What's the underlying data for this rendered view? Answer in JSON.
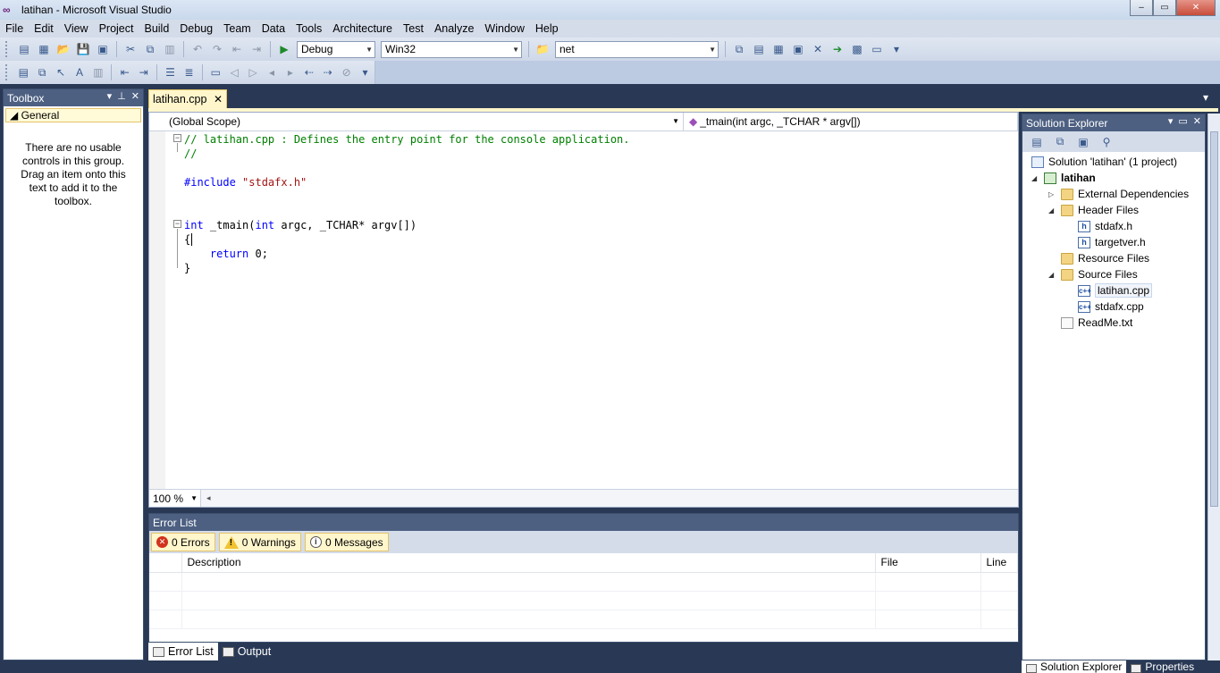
{
  "window": {
    "title": "latihan - Microsoft Visual Studio",
    "minimize": "–",
    "maximize": "▭",
    "close": "✕"
  },
  "menu": [
    "File",
    "Edit",
    "View",
    "Project",
    "Build",
    "Debug",
    "Team",
    "Data",
    "Tools",
    "Architecture",
    "Test",
    "Analyze",
    "Window",
    "Help"
  ],
  "toolbar": {
    "config": "Debug",
    "platform": "Win32",
    "find": "net"
  },
  "toolbox": {
    "title": "Toolbox",
    "group": "◢ General",
    "empty_message": "There are no usable controls in this group. Drag an item onto this text to add it to the toolbox."
  },
  "editor": {
    "tab_label": "latihan.cpp",
    "tab_close": "✕",
    "scope": "(Global Scope)",
    "member": "_tmain(int argc, _TCHAR * argv[])",
    "zoom": "100 %",
    "lines": {
      "l1": "// latihan.cpp : Defines the entry point for the console application.",
      "l2": "//",
      "l4_kw": "#include",
      "l4_str": " \"stdafx.h\"",
      "l7_kw1": "int",
      "l7_rest1": " _tmain(",
      "l7_kw2": "int",
      "l7_rest2": " argc, _TCHAR* argv[])",
      "l8": "{",
      "l9_kw": "return",
      "l9_rest": " 0;",
      "l10": "}"
    }
  },
  "error_list": {
    "title": "Error List",
    "errors": "0 Errors",
    "warnings": "0 Warnings",
    "messages": "0 Messages",
    "columns": [
      "",
      "Description",
      "File",
      "Line"
    ]
  },
  "bottom_tabs": [
    "Error List",
    "Output"
  ],
  "solution_explorer": {
    "title": "Solution Explorer",
    "items": [
      {
        "label": "Solution 'latihan' (1 project)"
      },
      {
        "label": "latihan"
      },
      {
        "label": "External Dependencies"
      },
      {
        "label": "Header Files"
      },
      {
        "label": "stdafx.h"
      },
      {
        "label": "targetver.h"
      },
      {
        "label": "Resource Files"
      },
      {
        "label": "Source Files"
      },
      {
        "label": "latihan.cpp"
      },
      {
        "label": "stdafx.cpp"
      },
      {
        "label": "ReadMe.txt"
      }
    ],
    "tabs": [
      "Solution Explorer",
      "Properties"
    ]
  },
  "colors": {
    "chrome": "#293955",
    "panel_header": "#4d6082",
    "active_tab": "#fff6cc"
  }
}
